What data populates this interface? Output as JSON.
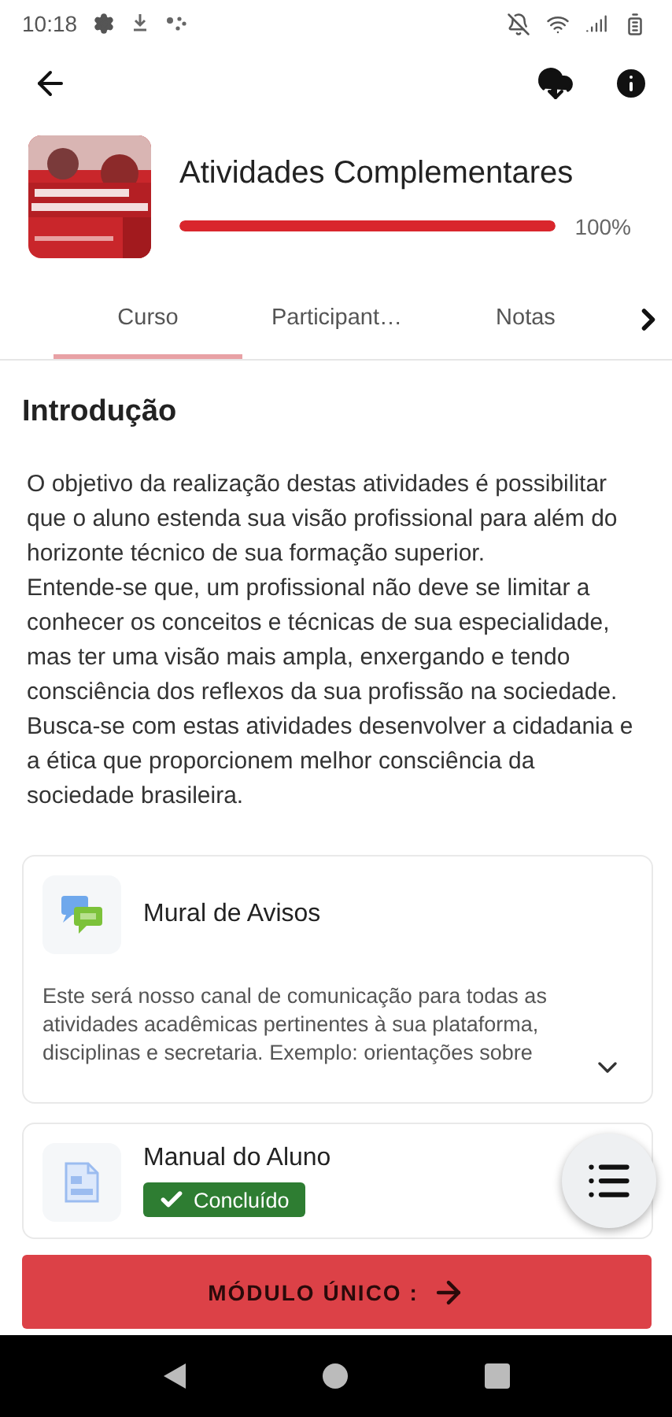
{
  "status_bar": {
    "time": "10:18"
  },
  "course": {
    "title": "Atividades Complementares",
    "progress": {
      "level": 1,
      "reading": "100%"
    }
  },
  "tabs": [
    {
      "label": "Curso",
      "selected": true
    },
    {
      "label": "Participant…",
      "selected": false
    },
    {
      "label": "Notas",
      "selected": false
    }
  ],
  "section": {
    "title": "Introdução",
    "text": "O objetivo da realização destas atividades é possibilitar que o aluno estenda sua visão profissional para além do horizonte técnico de sua formação superior.\nEntende-se que, um profissional não deve se limitar a conhecer os conceitos e técnicas de sua especialidade, mas ter uma visão mais ampla, enxergando e tendo consciência dos reflexos da sua profissão na sociedade. Busca-se com estas atividades desenvolver a cidadania e a ética que proporcionem melhor consciência da sociedade brasileira."
  },
  "modules": [
    {
      "kind": "forum",
      "title": "Mural de Avisos",
      "description": "Este será nosso canal de comunicação para todas as atividades acadêmicas pertinentes à sua plataforma, disciplinas e secretaria. Exemplo: orientações sobre",
      "expandable": true,
      "completed": false
    },
    {
      "kind": "resource",
      "title": "Manual do Aluno",
      "completed": true,
      "badge": "Concluído",
      "expandable": false
    }
  ],
  "bottom_button": {
    "label": "MÓDULO ÚNICO :"
  }
}
